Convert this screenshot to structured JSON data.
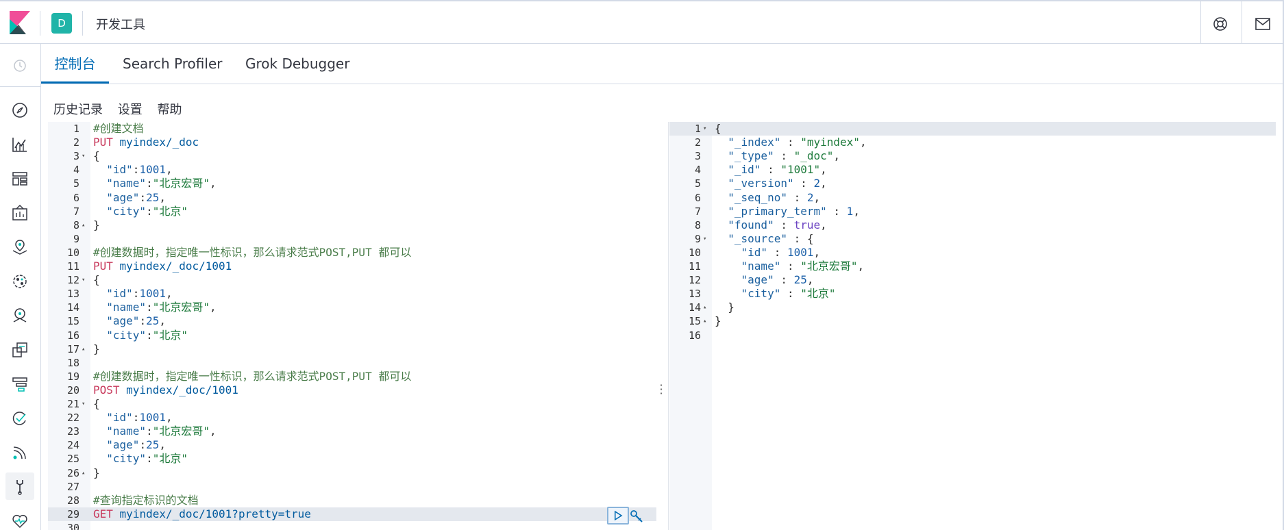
{
  "header": {
    "space_initial": "D",
    "title": "开发工具"
  },
  "tabs": [
    {
      "label": "控制台",
      "active": true
    },
    {
      "label": "Search Profiler",
      "active": false
    },
    {
      "label": "Grok Debugger",
      "active": false
    }
  ],
  "subnav": [
    "历史记录",
    "设置",
    "帮助"
  ],
  "nav_icons": [
    "recently-viewed-icon",
    "discover-icon",
    "visualize-icon",
    "dashboard-icon",
    "canvas-icon",
    "maps-icon",
    "machine-learning-icon",
    "infrastructure-icon",
    "logs-icon",
    "apm-icon",
    "uptime-icon",
    "siem-icon",
    "dev-tools-icon",
    "monitoring-icon"
  ],
  "colors": {
    "accent": "#006bb4",
    "space_badge": "#20b4a8",
    "comment": "#4a7d4a",
    "method": "#c8385b",
    "string": "#1d7a3b"
  },
  "request_editor": {
    "lines": [
      {
        "n": "1",
        "fold": "",
        "tokens": [
          [
            "cm",
            "#创建文档"
          ]
        ]
      },
      {
        "n": "2",
        "fold": "",
        "tokens": [
          [
            "kw",
            "PUT"
          ],
          [
            "p",
            " "
          ],
          [
            "url",
            "myindex/_doc"
          ]
        ]
      },
      {
        "n": "3",
        "fold": "▾",
        "tokens": [
          [
            "p",
            "{"
          ]
        ]
      },
      {
        "n": "4",
        "fold": "",
        "tokens": [
          [
            "p",
            "  "
          ],
          [
            "key",
            "\"id\""
          ],
          [
            "p",
            ":"
          ],
          [
            "num",
            "1001"
          ],
          [
            "p",
            ","
          ]
        ]
      },
      {
        "n": "5",
        "fold": "",
        "tokens": [
          [
            "p",
            "  "
          ],
          [
            "key",
            "\"name\""
          ],
          [
            "p",
            ":"
          ],
          [
            "str",
            "\"北京宏哥\""
          ],
          [
            "p",
            ","
          ]
        ]
      },
      {
        "n": "6",
        "fold": "",
        "tokens": [
          [
            "p",
            "  "
          ],
          [
            "key",
            "\"age\""
          ],
          [
            "p",
            ":"
          ],
          [
            "num",
            "25"
          ],
          [
            "p",
            ","
          ]
        ]
      },
      {
        "n": "7",
        "fold": "",
        "tokens": [
          [
            "p",
            "  "
          ],
          [
            "key",
            "\"city\""
          ],
          [
            "p",
            ":"
          ],
          [
            "str",
            "\"北京\""
          ]
        ]
      },
      {
        "n": "8",
        "fold": "▴",
        "tokens": [
          [
            "p",
            "}"
          ]
        ]
      },
      {
        "n": "9",
        "fold": "",
        "tokens": []
      },
      {
        "n": "10",
        "fold": "",
        "tokens": [
          [
            "cm",
            "#创建数据时，指定唯一性标识，那么请求范式POST,PUT 都可以"
          ]
        ]
      },
      {
        "n": "11",
        "fold": "",
        "tokens": [
          [
            "kw",
            "PUT"
          ],
          [
            "p",
            " "
          ],
          [
            "url",
            "myindex/_doc/1001"
          ]
        ]
      },
      {
        "n": "12",
        "fold": "▾",
        "tokens": [
          [
            "p",
            "{"
          ]
        ]
      },
      {
        "n": "13",
        "fold": "",
        "tokens": [
          [
            "p",
            "  "
          ],
          [
            "key",
            "\"id\""
          ],
          [
            "p",
            ":"
          ],
          [
            "num",
            "1001"
          ],
          [
            "p",
            ","
          ]
        ]
      },
      {
        "n": "14",
        "fold": "",
        "tokens": [
          [
            "p",
            "  "
          ],
          [
            "key",
            "\"name\""
          ],
          [
            "p",
            ":"
          ],
          [
            "str",
            "\"北京宏哥\""
          ],
          [
            "p",
            ","
          ]
        ]
      },
      {
        "n": "15",
        "fold": "",
        "tokens": [
          [
            "p",
            "  "
          ],
          [
            "key",
            "\"age\""
          ],
          [
            "p",
            ":"
          ],
          [
            "num",
            "25"
          ],
          [
            "p",
            ","
          ]
        ]
      },
      {
        "n": "16",
        "fold": "",
        "tokens": [
          [
            "p",
            "  "
          ],
          [
            "key",
            "\"city\""
          ],
          [
            "p",
            ":"
          ],
          [
            "str",
            "\"北京\""
          ]
        ]
      },
      {
        "n": "17",
        "fold": "▴",
        "tokens": [
          [
            "p",
            "}"
          ]
        ]
      },
      {
        "n": "18",
        "fold": "",
        "tokens": []
      },
      {
        "n": "19",
        "fold": "",
        "tokens": [
          [
            "cm",
            "#创建数据时，指定唯一性标识，那么请求范式POST,PUT 都可以"
          ]
        ]
      },
      {
        "n": "20",
        "fold": "",
        "tokens": [
          [
            "kw",
            "POST"
          ],
          [
            "p",
            " "
          ],
          [
            "url",
            "myindex/_doc/1001"
          ]
        ]
      },
      {
        "n": "21",
        "fold": "▾",
        "tokens": [
          [
            "p",
            "{"
          ]
        ]
      },
      {
        "n": "22",
        "fold": "",
        "tokens": [
          [
            "p",
            "  "
          ],
          [
            "key",
            "\"id\""
          ],
          [
            "p",
            ":"
          ],
          [
            "num",
            "1001"
          ],
          [
            "p",
            ","
          ]
        ]
      },
      {
        "n": "23",
        "fold": "",
        "tokens": [
          [
            "p",
            "  "
          ],
          [
            "key",
            "\"name\""
          ],
          [
            "p",
            ":"
          ],
          [
            "str",
            "\"北京宏哥\""
          ],
          [
            "p",
            ","
          ]
        ]
      },
      {
        "n": "24",
        "fold": "",
        "tokens": [
          [
            "p",
            "  "
          ],
          [
            "key",
            "\"age\""
          ],
          [
            "p",
            ":"
          ],
          [
            "num",
            "25"
          ],
          [
            "p",
            ","
          ]
        ]
      },
      {
        "n": "25",
        "fold": "",
        "tokens": [
          [
            "p",
            "  "
          ],
          [
            "key",
            "\"city\""
          ],
          [
            "p",
            ":"
          ],
          [
            "str",
            "\"北京\""
          ]
        ]
      },
      {
        "n": "26",
        "fold": "▴",
        "tokens": [
          [
            "p",
            "}"
          ]
        ]
      },
      {
        "n": "27",
        "fold": "",
        "tokens": []
      },
      {
        "n": "28",
        "fold": "",
        "tokens": [
          [
            "cm",
            "#查询指定标识的文档"
          ]
        ]
      },
      {
        "n": "29",
        "fold": "",
        "highlight": true,
        "tokens": [
          [
            "kw",
            "GET"
          ],
          [
            "p",
            " "
          ],
          [
            "url",
            "myindex/_doc/1001?pretty=true"
          ]
        ]
      },
      {
        "n": "30",
        "fold": "",
        "tokens": []
      }
    ]
  },
  "response_editor": {
    "lines": [
      {
        "n": "1",
        "fold": "▾",
        "highlight": true,
        "tokens": [
          [
            "p",
            "{"
          ]
        ]
      },
      {
        "n": "2",
        "fold": "",
        "tokens": [
          [
            "p",
            "  "
          ],
          [
            "key",
            "\"_index\""
          ],
          [
            "p",
            " : "
          ],
          [
            "str",
            "\"myindex\""
          ],
          [
            "p",
            ","
          ]
        ]
      },
      {
        "n": "3",
        "fold": "",
        "tokens": [
          [
            "p",
            "  "
          ],
          [
            "key",
            "\"_type\""
          ],
          [
            "p",
            " : "
          ],
          [
            "str",
            "\"_doc\""
          ],
          [
            "p",
            ","
          ]
        ]
      },
      {
        "n": "4",
        "fold": "",
        "tokens": [
          [
            "p",
            "  "
          ],
          [
            "key",
            "\"_id\""
          ],
          [
            "p",
            " : "
          ],
          [
            "str",
            "\"1001\""
          ],
          [
            "p",
            ","
          ]
        ]
      },
      {
        "n": "5",
        "fold": "",
        "tokens": [
          [
            "p",
            "  "
          ],
          [
            "key",
            "\"_version\""
          ],
          [
            "p",
            " : "
          ],
          [
            "num",
            "2"
          ],
          [
            "p",
            ","
          ]
        ]
      },
      {
        "n": "6",
        "fold": "",
        "tokens": [
          [
            "p",
            "  "
          ],
          [
            "key",
            "\"_seq_no\""
          ],
          [
            "p",
            " : "
          ],
          [
            "num",
            "2"
          ],
          [
            "p",
            ","
          ]
        ]
      },
      {
        "n": "7",
        "fold": "",
        "tokens": [
          [
            "p",
            "  "
          ],
          [
            "key",
            "\"_primary_term\""
          ],
          [
            "p",
            " : "
          ],
          [
            "num",
            "1"
          ],
          [
            "p",
            ","
          ]
        ]
      },
      {
        "n": "8",
        "fold": "",
        "tokens": [
          [
            "p",
            "  "
          ],
          [
            "key",
            "\"found\""
          ],
          [
            "p",
            " : "
          ],
          [
            "kwb",
            "true"
          ],
          [
            "p",
            ","
          ]
        ]
      },
      {
        "n": "9",
        "fold": "▾",
        "tokens": [
          [
            "p",
            "  "
          ],
          [
            "key",
            "\"_source\""
          ],
          [
            "p",
            " : {"
          ]
        ]
      },
      {
        "n": "10",
        "fold": "",
        "tokens": [
          [
            "p",
            "    "
          ],
          [
            "key",
            "\"id\""
          ],
          [
            "p",
            " : "
          ],
          [
            "num",
            "1001"
          ],
          [
            "p",
            ","
          ]
        ]
      },
      {
        "n": "11",
        "fold": "",
        "tokens": [
          [
            "p",
            "    "
          ],
          [
            "key",
            "\"name\""
          ],
          [
            "p",
            " : "
          ],
          [
            "str",
            "\"北京宏哥\""
          ],
          [
            "p",
            ","
          ]
        ]
      },
      {
        "n": "12",
        "fold": "",
        "tokens": [
          [
            "p",
            "    "
          ],
          [
            "key",
            "\"age\""
          ],
          [
            "p",
            " : "
          ],
          [
            "num",
            "25"
          ],
          [
            "p",
            ","
          ]
        ]
      },
      {
        "n": "13",
        "fold": "",
        "tokens": [
          [
            "p",
            "    "
          ],
          [
            "key",
            "\"city\""
          ],
          [
            "p",
            " : "
          ],
          [
            "str",
            "\"北京\""
          ]
        ]
      },
      {
        "n": "14",
        "fold": "▴",
        "tokens": [
          [
            "p",
            "  }"
          ]
        ]
      },
      {
        "n": "15",
        "fold": "▴",
        "tokens": [
          [
            "p",
            "}"
          ]
        ]
      },
      {
        "n": "16",
        "fold": "",
        "tokens": []
      }
    ]
  }
}
